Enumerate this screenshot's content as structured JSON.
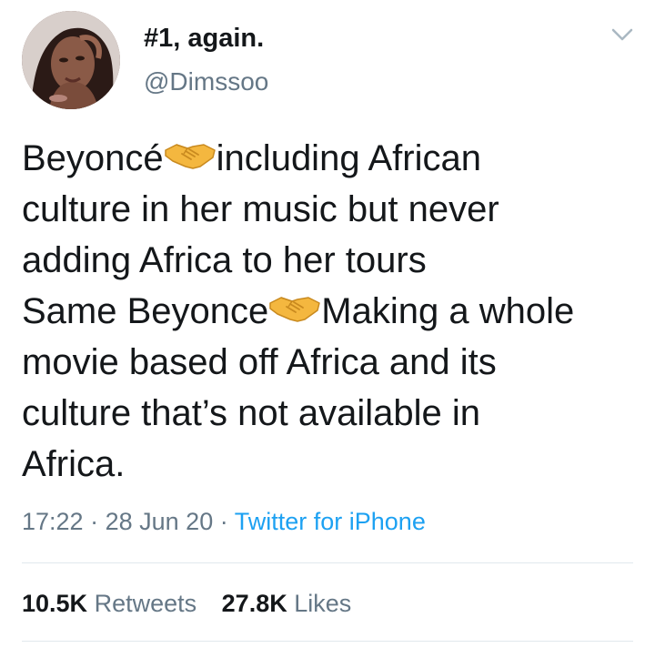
{
  "user": {
    "display_name": "#1, again.",
    "handle": "@Dimssoo"
  },
  "tweet": {
    "lines": [
      {
        "before": "Beyoncé",
        "emoji": "handshake-icon",
        "after": "including African"
      },
      {
        "text": "culture in her music but never"
      },
      {
        "text": "adding Africa to her tours"
      },
      {
        "before": "Same Beyonce",
        "emoji": "handshake-icon",
        "after": "Making a whole"
      },
      {
        "text": "movie based off Africa and its"
      },
      {
        "text": "culture that’s not available in"
      },
      {
        "text": "Africa."
      }
    ]
  },
  "meta": {
    "time": "17:22",
    "separator": "·",
    "date": "28 Jun 20",
    "source": "Twitter for iPhone"
  },
  "stats": {
    "retweets_count": "10.5K",
    "retweets_label": "Retweets",
    "likes_count": "27.8K",
    "likes_label": "Likes"
  },
  "colors": {
    "text": "#14171a",
    "secondary": "#657786",
    "link": "#1da1f2",
    "divider": "#e1e8ed",
    "emoji": "#f4b73f"
  },
  "icons": {
    "menu": "chevron-down-icon",
    "emoji": "handshake-icon"
  }
}
